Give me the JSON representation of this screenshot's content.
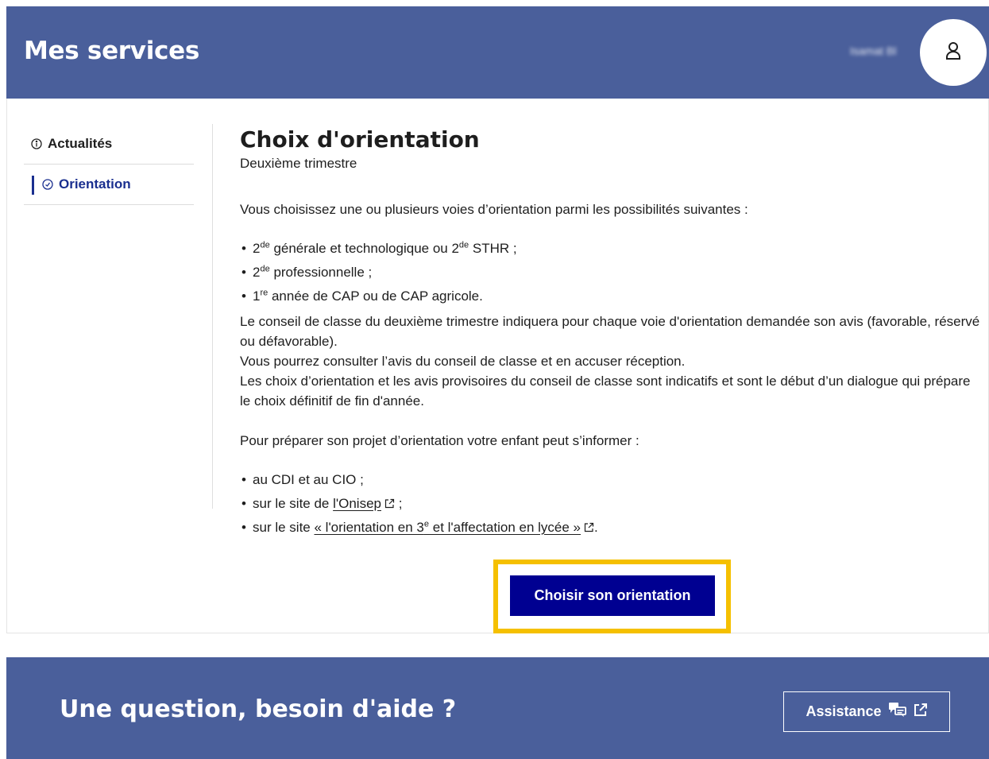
{
  "header": {
    "title": "Mes services",
    "user_name": "Isamat Bl",
    "avatar_icon": "user-icon"
  },
  "sidebar": {
    "items": [
      {
        "label": "Actualités",
        "icon": "info-circle-icon",
        "active": false
      },
      {
        "label": "Orientation",
        "icon": "clock-circle-icon",
        "active": true
      }
    ]
  },
  "main": {
    "title": "Choix d'orientation",
    "subtitle": "Deuxième trimestre",
    "intro": "Vous choisissez une ou plusieurs voies d’orientation parmi les possibilités suivantes :",
    "options": [
      {
        "p1": "2",
        "s1": "de",
        "p2": " générale et technologique ou 2",
        "s2": "de",
        "p3": " STHR ;"
      },
      {
        "p1": "2",
        "s1": "de",
        "p2": " professionnelle ;"
      },
      {
        "p1": "1",
        "s1": "re",
        "p2": " année de CAP ou de CAP agricole."
      }
    ],
    "paragraphs": [
      "Le conseil de classe du deuxième trimestre indiquera pour chaque voie d'orientation demandée son avis (favorable, réservé ou défavorable).",
      "Vous pourrez consulter l’avis du conseil de classe et en accuser réception.",
      "Les choix d’orientation et les avis provisoires du conseil de classe sont indicatifs et sont le début d’un dialogue qui prépare le choix définitif de fin d'année."
    ],
    "prepare": "Pour préparer son projet d’orientation votre enfant peut s’informer :",
    "links": [
      {
        "before": "au CDI et au CIO ;"
      },
      {
        "before": "sur le site de ",
        "link": "l'Onisep",
        "after": " ;"
      },
      {
        "before": "sur le site ",
        "link_a": "« l'orientation en 3",
        "link_sup": "e",
        "link_b": " et l'affectation en lycée »",
        "after": "."
      }
    ],
    "cta_label": "Choisir son orientation",
    "cta_highlight_color": "#f5c000",
    "cta_color": "#000091"
  },
  "footer": {
    "title": "Une question, besoin d'aide ?",
    "assistance_label": "Assistance",
    "assistance_icons": [
      "support-icon",
      "external-link-icon"
    ]
  },
  "colors": {
    "brand_blue": "#4a5f9b",
    "active_nav": "#1a2f8f"
  }
}
